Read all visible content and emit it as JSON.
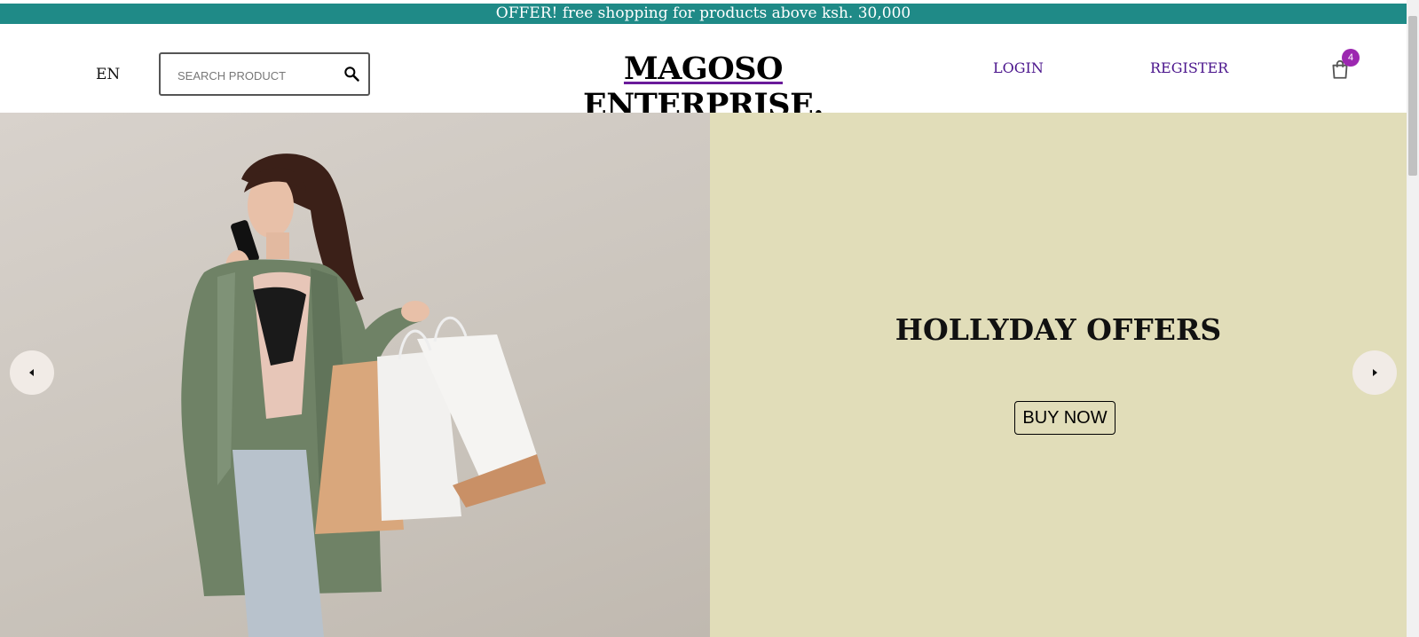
{
  "offer_bar": {
    "text": "OFFER! free shopping for products above ksh. 30,000"
  },
  "header": {
    "language": "EN",
    "search": {
      "placeholder": "SEARCH PRODUCT",
      "value": ""
    },
    "logo": "MAGOSO ENTERPRISE.",
    "nav": {
      "login": "LOGIN",
      "register": "REGISTER"
    },
    "cart": {
      "icon": "shopping-bag-icon",
      "count": "4"
    }
  },
  "hero": {
    "title": "HOLLYDAY OFFERS",
    "button_label": "BUY NOW",
    "image": "woman-with-shopping-bags-photo",
    "arrows": {
      "left_icon": "arrow-left-icon",
      "right_icon": "arrow-right-icon"
    }
  },
  "colors": {
    "offer_bar": "#1f8a87",
    "nav_link": "#4a148c",
    "badge": "#9c27b0",
    "slide_background": "#e1ddb9",
    "arrow_button": "#f1ebe6"
  }
}
